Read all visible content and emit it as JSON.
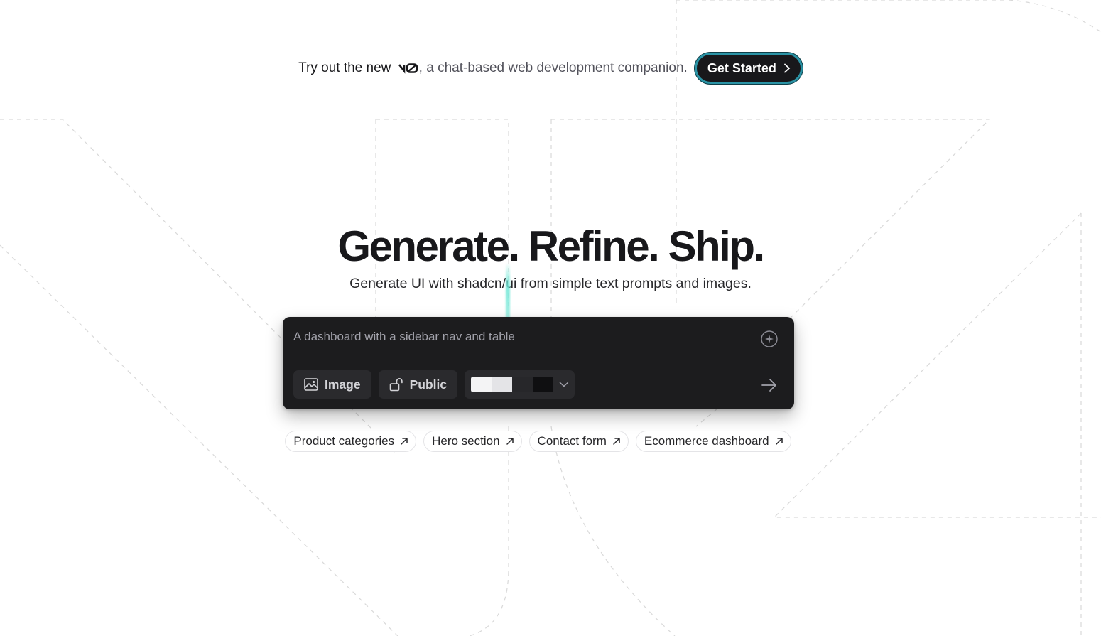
{
  "announcement": {
    "lead": "Try out the new",
    "brand": "v0",
    "tail": ", a chat-based web development companion.",
    "cta_label": "Get Started"
  },
  "hero": {
    "title": "Generate. Refine. Ship.",
    "subtitle": "Generate UI with shadcn/ui from simple text prompts and images."
  },
  "prompt": {
    "placeholder": "A dashboard with a sidebar nav and table",
    "image_label": "Image",
    "visibility_label": "Public",
    "theme_swatches": [
      "#f4f4f5",
      "#e4e4e7",
      "#27272a",
      "#0f0f11"
    ]
  },
  "suggestions": [
    {
      "label": "Product categories"
    },
    {
      "label": "Hero section"
    },
    {
      "label": "Contact form"
    },
    {
      "label": "Ecommerce dashboard"
    }
  ],
  "colors": {
    "accent": "#2a93a5",
    "dark": "#18181b",
    "glow": "#6ee7d6"
  },
  "icons": {
    "cta": "chevron-right-icon",
    "enhance": "sparkle-icon",
    "image": "image-icon",
    "visibility": "unlock-icon",
    "theme": "chevron-down-icon",
    "send": "arrow-right-icon",
    "chip": "arrow-up-right-icon"
  }
}
